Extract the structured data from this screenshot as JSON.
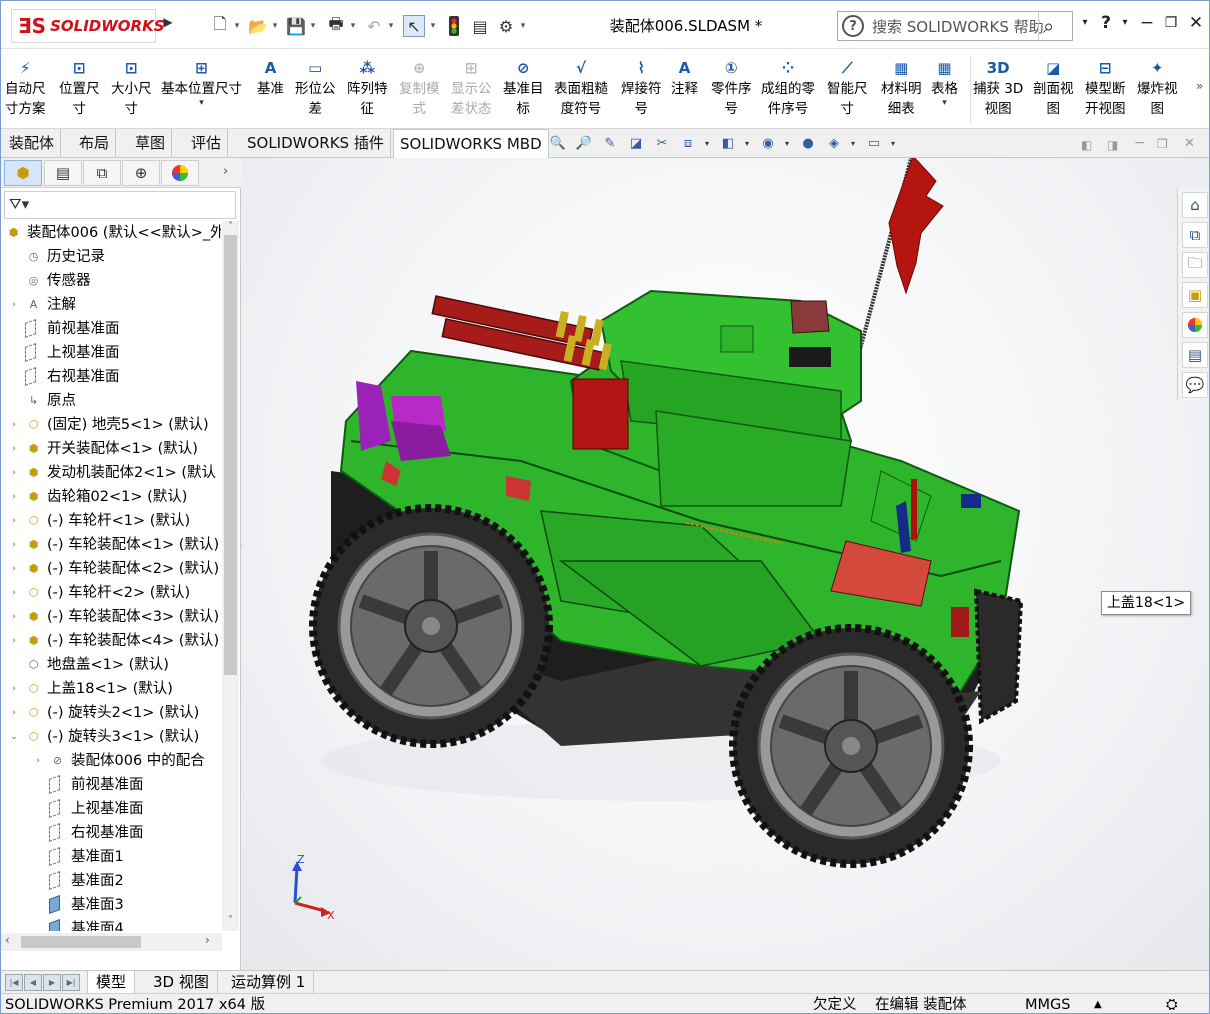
{
  "app": {
    "brand": "SOLIDWORKS",
    "doc_title": "装配体006.SLDASM *"
  },
  "help_search": {
    "placeholder": "搜索 SOLIDWORKS 帮助"
  },
  "ribbon": [
    {
      "l1": "自动尺",
      "l2": "寸方案",
      "icon": "auto-dimension-icon",
      "enabled": true
    },
    {
      "l1": "位置尺",
      "l2": "寸",
      "icon": "location-dimension-icon",
      "enabled": true
    },
    {
      "l1": "大小尺",
      "l2": "寸",
      "icon": "size-dimension-icon",
      "enabled": true
    },
    {
      "l1": "基本位置尺寸",
      "l2": "",
      "icon": "basic-location-dimension-icon",
      "enabled": true
    },
    {
      "l1": "基准",
      "l2": "",
      "icon": "datum-icon",
      "enabled": true
    },
    {
      "l1": "形位公",
      "l2": "差",
      "icon": "geometric-tolerance-icon",
      "enabled": true
    },
    {
      "l1": "阵列特",
      "l2": "征",
      "icon": "pattern-feature-icon",
      "enabled": true
    },
    {
      "l1": "复制模",
      "l2": "式",
      "icon": "copy-scheme-icon",
      "enabled": false
    },
    {
      "l1": "显示公",
      "l2": "差状态",
      "icon": "show-tolerance-status-icon",
      "enabled": false
    },
    {
      "l1": "基准目",
      "l2": "标",
      "icon": "datum-target-icon",
      "enabled": true
    },
    {
      "l1": "表面粗糙",
      "l2": "度符号",
      "icon": "surface-finish-icon",
      "enabled": true
    },
    {
      "l1": "焊接符",
      "l2": "号",
      "icon": "weld-symbol-icon",
      "enabled": true
    },
    {
      "l1": "注释",
      "l2": "",
      "icon": "note-icon",
      "enabled": true
    },
    {
      "l1": "零件序",
      "l2": "号",
      "icon": "balloon-icon",
      "enabled": true
    },
    {
      "l1": "成组的零",
      "l2": "件序号",
      "icon": "stacked-balloon-icon",
      "enabled": true
    },
    {
      "l1": "智能尺",
      "l2": "寸",
      "icon": "smart-dimension-icon",
      "enabled": true
    },
    {
      "l1": "材料明",
      "l2": "细表",
      "icon": "bom-icon",
      "enabled": true
    },
    {
      "l1": "表格",
      "l2": "",
      "icon": "table-icon",
      "enabled": true
    },
    {
      "l1": "捕获 3D",
      "l2": "视图",
      "icon": "capture-3d-view-icon",
      "enabled": true
    },
    {
      "l1": "剖面视",
      "l2": "图",
      "icon": "section-view-icon",
      "enabled": true
    },
    {
      "l1": "模型断",
      "l2": "开视图",
      "icon": "model-break-view-icon",
      "enabled": true
    },
    {
      "l1": "爆炸视",
      "l2": "图",
      "icon": "exploded-view-icon",
      "enabled": true
    }
  ],
  "command_tabs": [
    "装配体",
    "布局",
    "草图",
    "评估",
    "SOLIDWORKS 插件",
    "SOLIDWORKS MBD"
  ],
  "active_command_tab": "SOLIDWORKS MBD",
  "tree": [
    {
      "label": "装配体006  (默认<<默认>_外",
      "icon": "assembly",
      "indent": 0,
      "exp": ""
    },
    {
      "label": "历史记录",
      "icon": "history",
      "indent": 1,
      "exp": ""
    },
    {
      "label": "传感器",
      "icon": "sensor",
      "indent": 1,
      "exp": ""
    },
    {
      "label": "注解",
      "icon": "annotation",
      "indent": 1,
      "exp": ">"
    },
    {
      "label": "前视基准面",
      "icon": "plane",
      "indent": 1,
      "exp": ""
    },
    {
      "label": "上视基准面",
      "icon": "plane",
      "indent": 1,
      "exp": ""
    },
    {
      "label": "右视基准面",
      "icon": "plane",
      "indent": 1,
      "exp": ""
    },
    {
      "label": "原点",
      "icon": "origin",
      "indent": 1,
      "exp": ""
    },
    {
      "label": "(固定) 地壳5<1> (默认)",
      "icon": "part",
      "indent": 1,
      "exp": ">"
    },
    {
      "label": "开关装配体<1> (默认)",
      "icon": "asm",
      "indent": 1,
      "exp": ">"
    },
    {
      "label": "发动机装配体2<1> (默认",
      "icon": "asm",
      "indent": 1,
      "exp": ">"
    },
    {
      "label": "齿轮箱02<1> (默认)",
      "icon": "asm",
      "indent": 1,
      "exp": ">"
    },
    {
      "label": "(-) 车轮杆<1> (默认)",
      "icon": "part",
      "indent": 1,
      "exp": ">"
    },
    {
      "label": "(-) 车轮装配体<1> (默认)",
      "icon": "asm",
      "indent": 1,
      "exp": ">"
    },
    {
      "label": "(-) 车轮装配体<2> (默认)",
      "icon": "asm",
      "indent": 1,
      "exp": ">"
    },
    {
      "label": "(-) 车轮杆<2> (默认)",
      "icon": "part",
      "indent": 1,
      "exp": ">"
    },
    {
      "label": "(-) 车轮装配体<3> (默认)",
      "icon": "asm",
      "indent": 1,
      "exp": ">"
    },
    {
      "label": "(-) 车轮装配体<4> (默认)",
      "icon": "asm",
      "indent": 1,
      "exp": ">"
    },
    {
      "label": "地盘盖<1> (默认)",
      "icon": "partgray",
      "indent": 1,
      "exp": ""
    },
    {
      "label": "上盖18<1> (默认)",
      "icon": "part",
      "indent": 1,
      "exp": ">"
    },
    {
      "label": "(-) 旋转头2<1> (默认)",
      "icon": "part",
      "indent": 1,
      "exp": ">"
    },
    {
      "label": "(-) 旋转头3<1> (默认)",
      "icon": "part",
      "indent": 1,
      "exp": "v"
    },
    {
      "label": "装配体006 中的配合",
      "icon": "mates",
      "indent": 2,
      "exp": ">"
    },
    {
      "label": "前视基准面",
      "icon": "plane",
      "indent": 2,
      "exp": ""
    },
    {
      "label": "上视基准面",
      "icon": "plane",
      "indent": 2,
      "exp": ""
    },
    {
      "label": "右视基准面",
      "icon": "plane",
      "indent": 2,
      "exp": ""
    },
    {
      "label": "基准面1",
      "icon": "plane",
      "indent": 2,
      "exp": ""
    },
    {
      "label": "基准面2",
      "icon": "plane",
      "indent": 2,
      "exp": ""
    },
    {
      "label": "基准面3",
      "icon": "planefilled",
      "indent": 2,
      "exp": ""
    },
    {
      "label": "基准面4",
      "icon": "planefilled",
      "indent": 2,
      "exp": ""
    }
  ],
  "tooltip": "上盖18<1>",
  "triad": {
    "x": "X",
    "z": "Z"
  },
  "bottom_tabs": [
    "模型",
    "3D 视图",
    "运动算例 1"
  ],
  "active_bottom_tab": "模型",
  "status": {
    "product": "SOLIDWORKS Premium 2017 x64 版",
    "undefined": "欠定义",
    "editing": "在编辑 装配体",
    "units": "MMGS",
    "units_arrow": "▲"
  },
  "colors": {
    "accent": "#d0101a",
    "body_green": "#2fb52c",
    "tree_icon": "#c69b10"
  }
}
